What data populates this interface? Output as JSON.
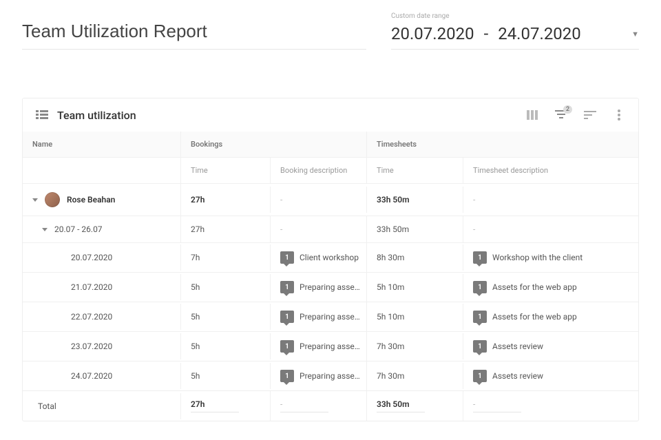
{
  "header": {
    "report_title": "Team Utilization Report",
    "date_range_label": "Custom date range",
    "date_start": "20.07.2020",
    "date_sep": "-",
    "date_end": "24.07.2020"
  },
  "card": {
    "title": "Team utilization",
    "filter_badge": "2"
  },
  "columns": {
    "name": "Name",
    "bookings": "Bookings",
    "timesheets": "Timesheets",
    "booking_time": "Time",
    "booking_desc": "Booking description",
    "timesheet_time": "Time",
    "timesheet_desc": "Timesheet description"
  },
  "chip_label": "1",
  "dash": "-",
  "person": {
    "name": "Rose Beahan",
    "booking_time": "27h",
    "timesheet_time": "33h 50m"
  },
  "week": {
    "label": "20.07 - 26.07",
    "booking_time": "27h",
    "timesheet_time": "33h 50m"
  },
  "days": [
    {
      "date": "20.07.2020",
      "b_time": "7h",
      "b_desc": "Client workshop",
      "t_time": "8h 30m",
      "t_desc": "Workshop with the client"
    },
    {
      "date": "21.07.2020",
      "b_time": "5h",
      "b_desc": "Preparing asse…",
      "t_time": "5h 10m",
      "t_desc": "Assets for the web app"
    },
    {
      "date": "22.07.2020",
      "b_time": "5h",
      "b_desc": "Preparing asse…",
      "t_time": "5h 10m",
      "t_desc": "Assets for the web app"
    },
    {
      "date": "23.07.2020",
      "b_time": "5h",
      "b_desc": "Preparing asse…",
      "t_time": "7h 30m",
      "t_desc": "Assets review"
    },
    {
      "date": "24.07.2020",
      "b_time": "5h",
      "b_desc": "Preparing asse…",
      "t_time": "7h 30m",
      "t_desc": "Assets review"
    }
  ],
  "total": {
    "label": "Total",
    "booking_time": "27h",
    "timesheet_time": "33h 50m"
  }
}
